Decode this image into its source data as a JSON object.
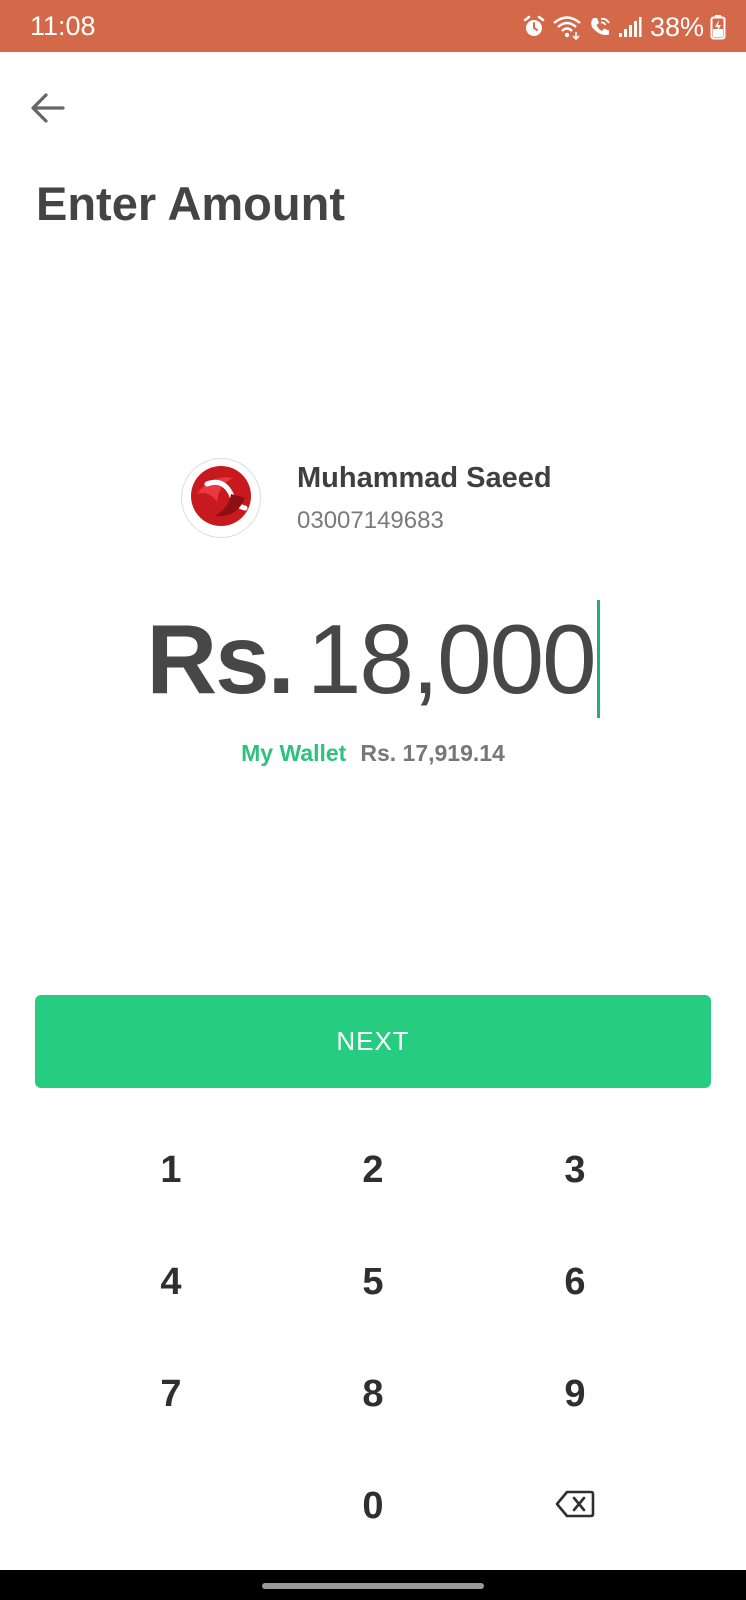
{
  "status_bar": {
    "time": "11:08",
    "battery": "38%",
    "icons": [
      "alarm-icon",
      "wifi-icon",
      "wifi-calling-icon",
      "signal-icon",
      "battery-icon"
    ],
    "background_color": "#d4694a"
  },
  "header": {
    "back_icon": "arrow-left-icon",
    "title": "Enter Amount"
  },
  "recipient": {
    "name": "Muhammad Saeed",
    "phone": "03007149683",
    "avatar_icon": "network-logo-icon"
  },
  "amount": {
    "currency": "Rs.",
    "value": "18,000"
  },
  "wallet": {
    "label": "My Wallet",
    "balance": "Rs. 17,919.14"
  },
  "next_button": {
    "label": "NEXT",
    "color": "#26cd81"
  },
  "keypad": {
    "keys": [
      "1",
      "2",
      "3",
      "4",
      "5",
      "6",
      "7",
      "8",
      "9",
      "0"
    ],
    "backspace_icon": "backspace-icon"
  },
  "colors": {
    "accent_green": "#2ec27e",
    "cursor": "#26ab7c",
    "text_dark": "#444444"
  }
}
